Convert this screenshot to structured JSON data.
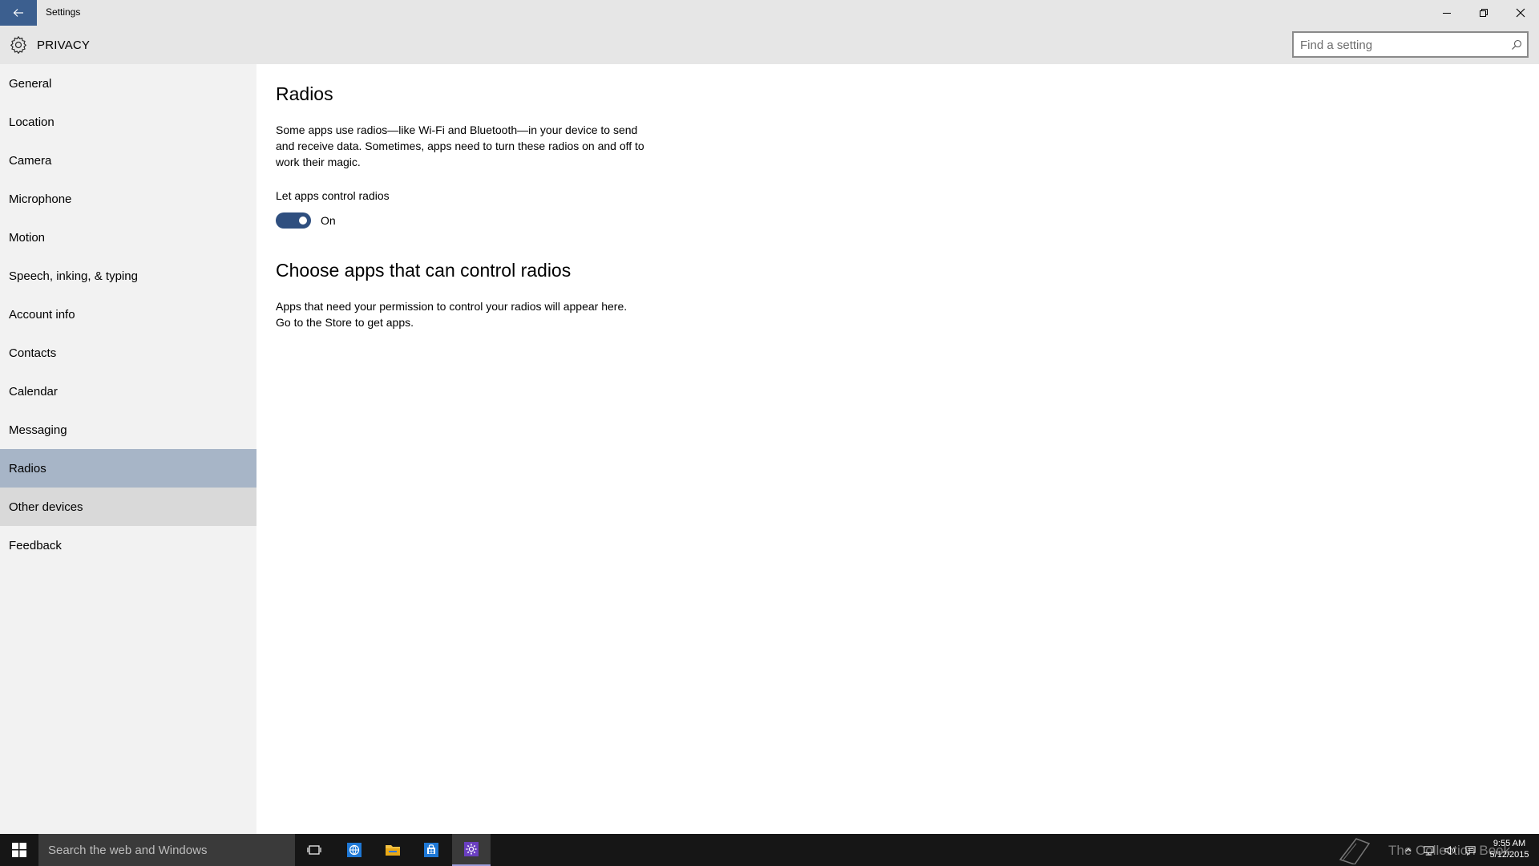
{
  "window": {
    "title": "Settings",
    "back_icon": "back-arrow-icon",
    "minimize_icon": "minimize-icon",
    "maximize_icon": "restore-icon",
    "close_icon": "close-icon"
  },
  "header": {
    "icon": "gear-icon",
    "title": "PRIVACY",
    "search_placeholder": "Find a setting",
    "search_icon": "search-icon"
  },
  "sidebar": {
    "items": [
      {
        "label": "General"
      },
      {
        "label": "Location"
      },
      {
        "label": "Camera"
      },
      {
        "label": "Microphone"
      },
      {
        "label": "Motion"
      },
      {
        "label": "Speech, inking, & typing"
      },
      {
        "label": "Account info"
      },
      {
        "label": "Contacts"
      },
      {
        "label": "Calendar"
      },
      {
        "label": "Messaging"
      },
      {
        "label": "Radios"
      },
      {
        "label": "Other devices"
      },
      {
        "label": "Feedback"
      }
    ],
    "selected": "Radios",
    "hovered": "Other devices"
  },
  "main": {
    "heading": "Radios",
    "description": "Some apps use radios—like Wi-Fi and Bluetooth—in your device to send and receive data. Sometimes, apps need to turn these radios on and off to work their magic.",
    "toggle_label": "Let apps control radios",
    "toggle_state": "On",
    "toggle_on": true,
    "accent_color": "#2f4f7f",
    "subheading": "Choose apps that can control radios",
    "apps_description": "Apps that need your permission to control your radios will appear here. Go to the Store to get apps."
  },
  "taskbar": {
    "start_icon": "windows-logo-icon",
    "search_text": "Search the web and Windows",
    "pinned": [
      {
        "icon": "task-view-icon"
      },
      {
        "icon": "edge-browser-icon"
      },
      {
        "icon": "file-explorer-icon"
      },
      {
        "icon": "store-icon"
      },
      {
        "icon": "settings-gear-icon"
      }
    ],
    "tray_icons": [
      "chevron-up-icon",
      "network-icon",
      "volume-icon",
      "action-center-icon"
    ],
    "time": "9:55 AM",
    "date": "5/12/2015",
    "watermark": "The Collection Book"
  }
}
